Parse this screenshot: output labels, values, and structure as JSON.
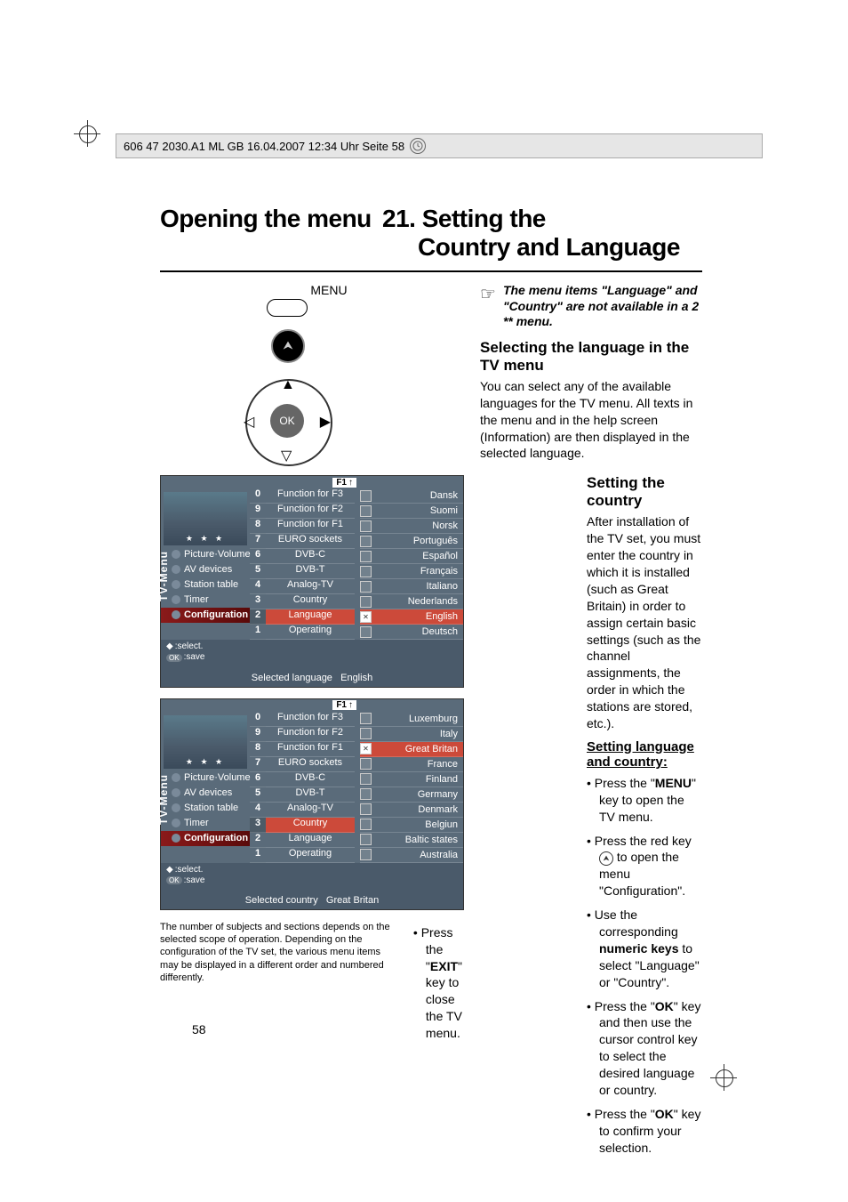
{
  "header": {
    "text": "606 47 2030.A1  ML GB  16.04.2007  12:34 Uhr  Seite 58"
  },
  "titles": {
    "left": "Opening the menu",
    "right_num": "21.",
    "right_a": "Setting the",
    "right_b": "Country and Language"
  },
  "remote": {
    "menu_label": "MENU",
    "ok_label": "OK"
  },
  "screenshot1": {
    "f1": "F1",
    "sidebar_vert": "TV-Menu",
    "sidebar_items": [
      "Picture·Volume",
      "AV devices",
      "Station table",
      "Timer",
      "Configuration"
    ],
    "sidebar_active_index": 4,
    "numbers": [
      "0",
      "9",
      "8",
      "7",
      "6",
      "5",
      "4",
      "3",
      "2",
      "1"
    ],
    "mid": [
      "Function for F3",
      "Function for F2",
      "Function for F1",
      "EURO sockets",
      "DVB-C",
      "DVB-T",
      "Analog-TV",
      "Country",
      "Language",
      "Operating"
    ],
    "mid_hl_index": 8,
    "right": [
      "Dansk",
      "Suomi",
      "Norsk",
      "Português",
      "Español",
      "Français",
      "Italiano",
      "Nederlands",
      "English",
      "Deutsch"
    ],
    "right_hl_index": 8,
    "hint_select": ":select.",
    "hint_save": ":save",
    "hint_ok": "OK",
    "selected_label": "Selected language",
    "selected_value": "English"
  },
  "screenshot2": {
    "f1": "F1",
    "sidebar_vert": "TV-Menu",
    "sidebar_items": [
      "Picture·Volume",
      "AV devices",
      "Station table",
      "Timer",
      "Configuration"
    ],
    "sidebar_active_index": 4,
    "numbers": [
      "0",
      "9",
      "8",
      "7",
      "6",
      "5",
      "4",
      "3",
      "2",
      "1"
    ],
    "mid": [
      "Function for F3",
      "Function for F2",
      "Function for F1",
      "EURO sockets",
      "DVB-C",
      "DVB-T",
      "Analog-TV",
      "Country",
      "Language",
      "Operating"
    ],
    "mid_hl_index": 7,
    "right": [
      "Luxemburg",
      "Italy",
      "Great Britan",
      "France",
      "Finland",
      "Germany",
      "Denmark",
      "Belgiun",
      "Baltic states",
      "Australia"
    ],
    "right_hl_index": 2,
    "hint_select": ":select.",
    "hint_save": ":save",
    "hint_ok": "OK",
    "selected_label": "Selected country",
    "selected_value": "Great Britan"
  },
  "footnote": "The number of subjects and sections depends on the selected scope of operation. Depending on the configuration of the TV set, the various menu items may be displayed in a different order and numbered differently.",
  "note_text": "The menu items \"Language\" and \"Country\" are not available in a 2 ** menu.",
  "sections": {
    "selecting_h": "Selecting the language in the TV menu",
    "selecting_p": "You can select any of the available languages for the TV menu. All texts in the menu and in the help screen (Information) are then displayed in the selected language.",
    "setting_country_h": "Setting the country",
    "setting_country_p": "After installation of the TV set, you must enter the country in which it is installed (such as Great Britain) in order to assign certain basic settings (such as the channel assignments, the order in which the stations are stored, etc.).",
    "setting_lang_country_h": "Setting language and country:",
    "steps": {
      "s1_a": "Press the \"",
      "s1_b": "MENU",
      "s1_c": "\" key to open the TV menu.",
      "s2_a": "Press the red key ",
      "s2_b": " to open the menu \"Configuration\".",
      "s3_a": "Use the corresponding ",
      "s3_b": "numeric keys",
      "s3_c": " to select \"Language\" or \"Country\".",
      "s4_a": "Press the \"",
      "s4_b": "OK",
      "s4_c": "\" key and then use the cursor control key to select the desired language or country.",
      "s5_a": "Press the \"",
      "s5_b": "OK",
      "s5_c": "\" key to confirm your selection.",
      "exit_a": "• Press the \"",
      "exit_b": "EXIT",
      "exit_c": "\" key to close the TV menu."
    }
  },
  "page_number": "58"
}
